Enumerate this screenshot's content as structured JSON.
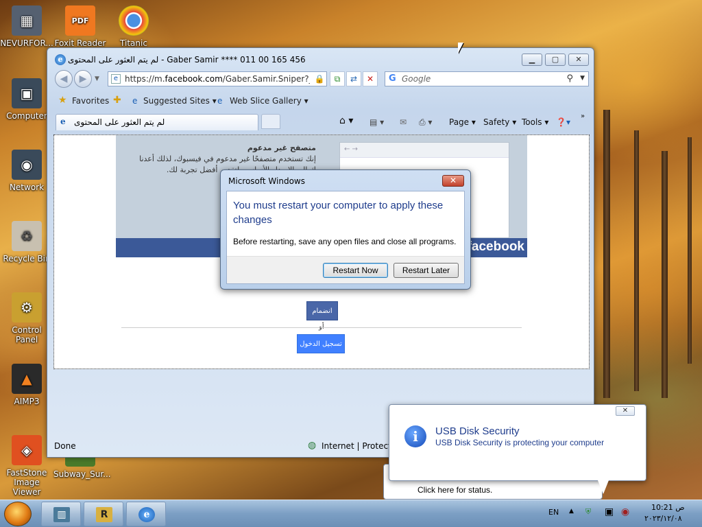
{
  "desktop": {
    "icons": [
      {
        "label": "NEVURFOR...",
        "icon": "media-folder-icon",
        "color": "#556070"
      },
      {
        "label": "Computer",
        "icon": "computer-icon",
        "color": "#3a4a5a"
      },
      {
        "label": "Network",
        "icon": "network-icon",
        "color": "#3a4a5a"
      },
      {
        "label": "Recycle Bin",
        "icon": "recycle-bin-icon",
        "color": "#c8c0b0"
      },
      {
        "label": "Control Panel",
        "icon": "control-panel-icon",
        "color": "#c9a030"
      },
      {
        "label": "AIMP3",
        "icon": "aimp-icon",
        "color": "#2a2a2a"
      },
      {
        "label": "FastStone Image Viewer",
        "icon": "faststone-icon",
        "color": "#e05020"
      },
      {
        "label": "Foxit Reader",
        "icon": "foxit-pdf-icon",
        "color": "#f07820"
      },
      {
        "label": "Titanic",
        "icon": "chrome-icon",
        "color": "#2a8a3a"
      },
      {
        "label": "Subway_Sur...",
        "icon": "subway-icon",
        "color": "#4a7a2a"
      }
    ]
  },
  "ie": {
    "title": "لم يتم العثور على المحتوى - Gaber Samir **** 011 00 165 456",
    "url_prefix": "https://m.",
    "url_domain": "facebook.com",
    "url_rest": "/Gaber.Samir.Sniper?_r",
    "search_placeholder": "Google",
    "favorites_label": "Favorites",
    "suggested_sites": "Suggested Sites",
    "web_slice_gallery": "Web Slice Gallery",
    "tab_title": "لم يتم العثور على المحتوى",
    "page_menu": "Page",
    "safety_menu": "Safety",
    "tools_menu": "Tools",
    "status_done": "Done",
    "status_zone": "Internet | Protected"
  },
  "fb": {
    "heading": "متصفح غير مدعوم",
    "line1": "إنك تستخدم متصفحًا غير مدعوم في فيسبوك، لذلك أعدنا",
    "line2": "ك إلى الإصدار الأساسي لتقديم أفضل تجربة لك.",
    "logo": "facebook",
    "join": "انضمام",
    "or": "أو",
    "login": "تسجيل الدخول"
  },
  "dialog": {
    "title": "Microsoft Windows",
    "main": "You must restart your computer to apply these changes",
    "sub": "Before restarting, save any open files and close all programs.",
    "restart_now": "Restart Now",
    "restart_later": "Restart Later"
  },
  "notification": {
    "title": "USB Disk Security",
    "message": "USB Disk Security is protecting your computer",
    "behind_text": "Click here for status."
  },
  "taskbar": {
    "lang": "EN",
    "time": "10:21 ص",
    "date": "٢٠٢٣/١٢/٠٨"
  }
}
